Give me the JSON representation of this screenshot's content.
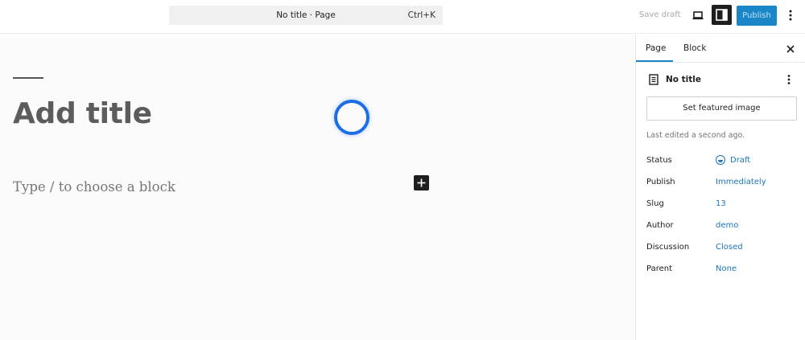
{
  "topbar": {
    "document_title": "No title · Page",
    "shortcut": "Ctrl+K",
    "save_draft_label": "Save draft",
    "publish_label": "Publish",
    "device_icon": "laptop-icon",
    "panel_icon": "sidebar-toggle-icon",
    "more_icon": "more-vertical-icon"
  },
  "canvas": {
    "title_placeholder": "Add title",
    "block_placeholder": "Type / to choose a block",
    "inserter_icon": "plus-icon",
    "loading_icon": "spinner-icon"
  },
  "sidebar": {
    "tabs": [
      {
        "label": "Page",
        "active": true
      },
      {
        "label": "Block",
        "active": false
      }
    ],
    "close_icon": "close-icon",
    "document": {
      "icon": "page-icon",
      "title": "No title",
      "more_icon": "more-vertical-icon"
    },
    "featured_image_label": "Set featured image",
    "last_edited": "Last edited a second ago.",
    "rows": [
      {
        "label": "Status",
        "value": "Draft"
      },
      {
        "label": "Publish",
        "value": "Immediately"
      },
      {
        "label": "Slug",
        "value": "13"
      },
      {
        "label": "Author",
        "value": "demo"
      },
      {
        "label": "Discussion",
        "value": "Closed"
      },
      {
        "label": "Parent",
        "value": "None"
      }
    ]
  },
  "colors": {
    "accent": "#1a86c7",
    "link": "#1a76b8",
    "spinner": "#1b6ee8",
    "dark": "#1e1e1e"
  }
}
